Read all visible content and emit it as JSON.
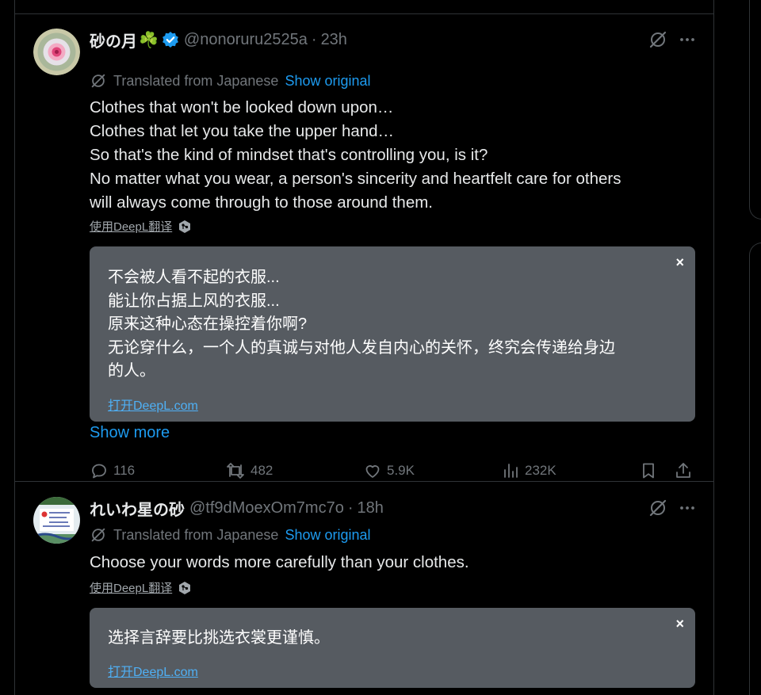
{
  "tweets": [
    {
      "author_name": "砂の月",
      "name_emoji": "☘️",
      "handle": "@nonoruru2525a",
      "separator": "·",
      "time": "23h",
      "translated_label": "Translated from Japanese",
      "show_original": "Show original",
      "text_lines": [
        "Clothes that won't be looked down upon…",
        "Clothes that let you take the upper hand…",
        "So that's the kind of mindset that's controlling you, is it?",
        "No matter what you wear, a person's sincerity and heartfelt care for others",
        "will always come through to those around them."
      ],
      "deepl_link": "使用DeepL翻译",
      "popup_lines": [
        "不会被人看不起的衣服...",
        "能让你占据上风的衣服...",
        "原来这种心态在操控着你啊?",
        "无论穿什么，一个人的真诚与对他人发自内心的关怀，终究会传递给身边",
        "的人。"
      ],
      "popup_close": "×",
      "popup_open_link": "打开DeepL.com",
      "show_more": "Show more",
      "replies": "116",
      "reposts": "482",
      "likes": "5.9K",
      "views": "232K"
    },
    {
      "author_name": "れいわ星の砂",
      "handle": "@tf9dMoexOm7mc7o",
      "separator": "·",
      "time": "18h",
      "translated_label": "Translated from Japanese",
      "show_original": "Show original",
      "text_lines": [
        "Choose your words more carefully than your clothes."
      ],
      "deepl_link": "使用DeepL翻译",
      "popup_lines": [
        "选择言辞要比挑选衣裳更谨慎。"
      ],
      "popup_close": "×",
      "popup_open_link": "打开DeepL.com"
    }
  ],
  "icons": {
    "grok": "grok-icon",
    "more": "more-dots-icon",
    "reply": "reply-icon",
    "repost": "repost-icon",
    "like": "like-icon",
    "views": "views-icon",
    "bookmark": "bookmark-icon",
    "share": "share-icon",
    "verified": "verified-badge-icon",
    "deepl": "deepl-cube-icon",
    "translate": "translate-icon"
  },
  "colors": {
    "background": "#000000",
    "accent": "#1d9bf0",
    "muted": "#71767b",
    "popup_bg": "#565b61",
    "verified": "#1d9bf0"
  }
}
